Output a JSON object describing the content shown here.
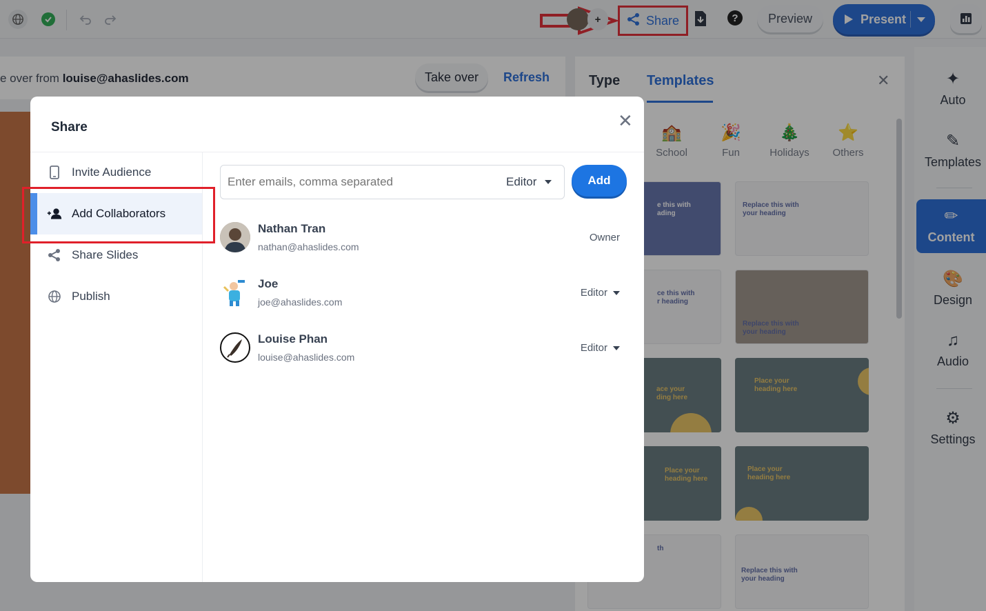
{
  "topbar": {
    "share_label": "Share",
    "preview_label": "Preview",
    "present_label": "Present",
    "avatar_plus": "+"
  },
  "background": {
    "takeover_prefix": "e over from ",
    "takeover_email": "louise@ahaslides.com",
    "takeover_button": "Take over",
    "refresh_button": "Refresh"
  },
  "templates_panel": {
    "tab_type": "Type",
    "tab_templates": "Templates",
    "categories": [
      "School",
      "Fun",
      "Holidays",
      "Others"
    ],
    "thumbs": [
      "e this with\nading",
      "Replace this with\nyour heading",
      "ce this with\nr heading",
      "Replace this with\nyour heading",
      "ace your\nding here",
      "Place your\nheading here",
      "Place your\nheading here",
      "Place your\nheading here",
      "th",
      "Replace this with\nyour heading"
    ]
  },
  "right_sidebar": {
    "auto": "Auto",
    "templates": "Templates",
    "content": "Content",
    "design": "Design",
    "audio": "Audio",
    "settings": "Settings"
  },
  "modal": {
    "title": "Share",
    "nav": [
      {
        "label": "Invite Audience"
      },
      {
        "label": "Add Collaborators"
      },
      {
        "label": "Share Slides"
      },
      {
        "label": "Publish"
      }
    ],
    "email_placeholder": "Enter emails, comma separated",
    "role_selected": "Editor",
    "add_label": "Add",
    "members": [
      {
        "name": "Nathan Tran",
        "email": "nathan@ahaslides.com",
        "role": "Owner"
      },
      {
        "name": "Joe",
        "email": "joe@ahaslides.com",
        "role": "Editor"
      },
      {
        "name": "Louise Phan",
        "email": "louise@ahaslides.com",
        "role": "Editor"
      }
    ]
  },
  "colors": {
    "accent": "#1d64d6",
    "annotation": "#e0202a"
  }
}
